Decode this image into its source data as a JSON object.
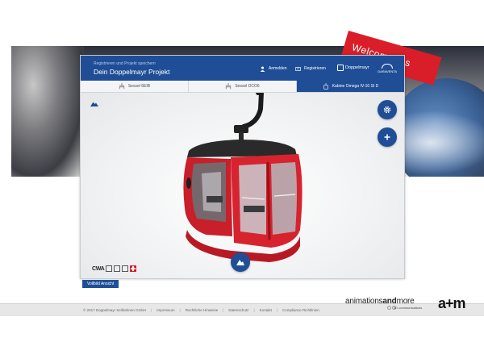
{
  "background": {
    "ribbon_text": "Welcome ...s"
  },
  "header": {
    "subtitle": "Registrieren und Projekt speichern",
    "title": "Dein Doppelmayr Projekt",
    "login_label": "Anmelden",
    "register_label": "Registrieren",
    "doppelmayr_logo": "Doppelmayr",
    "garaventa_logo": "GARAVENTA"
  },
  "tabs": [
    {
      "label": "Sessel 6EIB",
      "icon": "chairlift-icon",
      "active": false
    },
    {
      "label": "Sessel DCO6",
      "icon": "chairlift-icon",
      "active": false
    },
    {
      "label": "Kabine Omega IV-10 SI D",
      "icon": "gondola-icon",
      "active": true
    }
  ],
  "viewer": {
    "brand": "CWA",
    "cabin_color": "#d6232e"
  },
  "full_view_label": "Vollbild Ansicht",
  "footer": {
    "copyright": "© 2017 Doppelmayr Seilbahnen GmbH",
    "links": [
      "Impressum",
      "Rechtliche Hinweise",
      "Datenschutz",
      "Kontakt",
      "Compliance Richtlinien"
    ]
  },
  "credit": {
    "name_light": "animations",
    "name_bold": "and",
    "name_light2": "more",
    "tagline": "3D communications",
    "logo": "a+m"
  },
  "colors": {
    "primary": "#1f4e97",
    "accent": "#d91e2a"
  }
}
